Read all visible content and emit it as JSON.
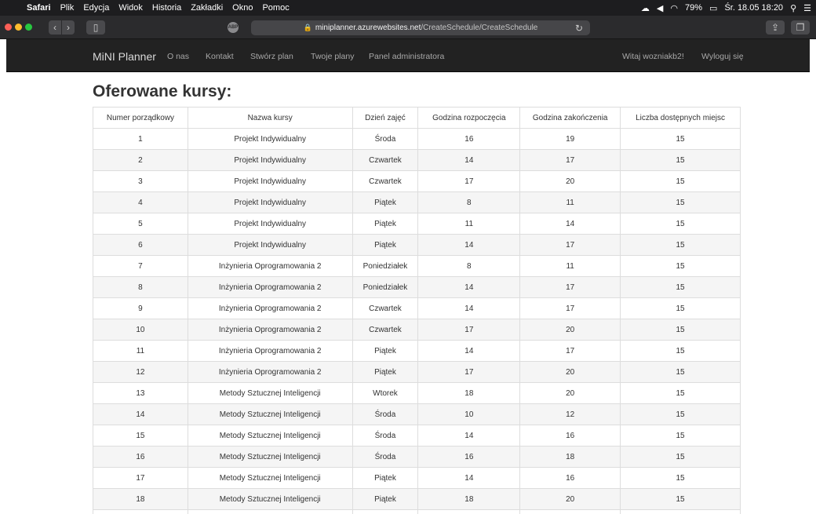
{
  "menubar": {
    "app": "Safari",
    "items": [
      "Plik",
      "Edycja",
      "Widok",
      "Historia",
      "Zakładki",
      "Okno",
      "Pomoc"
    ],
    "battery": "79%",
    "datetime": "Śr. 18.05 18:20"
  },
  "browser": {
    "url_host": "miniplanner.azurewebsites.net",
    "url_path": "/CreateSchedule/CreateSchedule",
    "extension_label": "ABP"
  },
  "navbar": {
    "brand": "MiNI Planner",
    "links": [
      "O nas",
      "Kontakt",
      "Stwórz plan",
      "Twoje plany",
      "Panel administratora"
    ],
    "greeting": "Witaj wozniakb2!",
    "logout": "Wyloguj się"
  },
  "page": {
    "title": "Oferowane kursy:"
  },
  "table": {
    "headers": [
      "Numer porządkowy",
      "Nazwa kursy",
      "Dzień zajęć",
      "Godzina rozpoczęcia",
      "Godzina zakończenia",
      "Liczba dostępnych miejsc"
    ],
    "rows": [
      [
        "1",
        "Projekt Indywidualny",
        "Środa",
        "16",
        "19",
        "15"
      ],
      [
        "2",
        "Projekt Indywidualny",
        "Czwartek",
        "14",
        "17",
        "15"
      ],
      [
        "3",
        "Projekt Indywidualny",
        "Czwartek",
        "17",
        "20",
        "15"
      ],
      [
        "4",
        "Projekt Indywidualny",
        "Piątek",
        "8",
        "11",
        "15"
      ],
      [
        "5",
        "Projekt Indywidualny",
        "Piątek",
        "11",
        "14",
        "15"
      ],
      [
        "6",
        "Projekt Indywidualny",
        "Piątek",
        "14",
        "17",
        "15"
      ],
      [
        "7",
        "Inżynieria Oprogramowania 2",
        "Poniedziałek",
        "8",
        "11",
        "15"
      ],
      [
        "8",
        "Inżynieria Oprogramowania 2",
        "Poniedziałek",
        "14",
        "17",
        "15"
      ],
      [
        "9",
        "Inżynieria Oprogramowania 2",
        "Czwartek",
        "14",
        "17",
        "15"
      ],
      [
        "10",
        "Inżynieria Oprogramowania 2",
        "Czwartek",
        "17",
        "20",
        "15"
      ],
      [
        "11",
        "Inżynieria Oprogramowania 2",
        "Piątek",
        "14",
        "17",
        "15"
      ],
      [
        "12",
        "Inżynieria Oprogramowania 2",
        "Piątek",
        "17",
        "20",
        "15"
      ],
      [
        "13",
        "Metody Sztucznej Inteligencji",
        "Wtorek",
        "18",
        "20",
        "15"
      ],
      [
        "14",
        "Metody Sztucznej Inteligencji",
        "Środa",
        "10",
        "12",
        "15"
      ],
      [
        "15",
        "Metody Sztucznej Inteligencji",
        "Środa",
        "14",
        "16",
        "15"
      ],
      [
        "16",
        "Metody Sztucznej Inteligencji",
        "Środa",
        "16",
        "18",
        "15"
      ],
      [
        "17",
        "Metody Sztucznej Inteligencji",
        "Piątek",
        "14",
        "16",
        "15"
      ],
      [
        "18",
        "Metody Sztucznej Inteligencji",
        "Piątek",
        "18",
        "20",
        "15"
      ],
      [
        "",
        "",
        "",
        "",
        "",
        ""
      ]
    ]
  }
}
